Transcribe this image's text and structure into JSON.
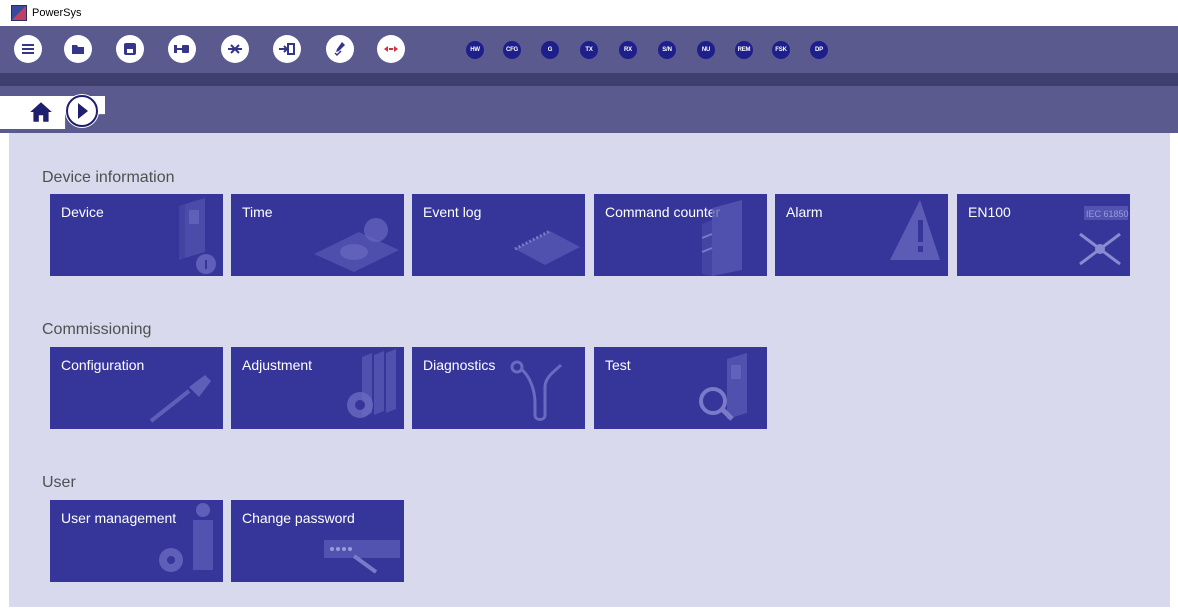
{
  "window": {
    "title": "PowerSys"
  },
  "toolbar": {
    "buttons": [
      {
        "name": "menu"
      },
      {
        "name": "open"
      },
      {
        "name": "save"
      },
      {
        "name": "connect"
      },
      {
        "name": "disconnect"
      },
      {
        "name": "login"
      },
      {
        "name": "edit"
      },
      {
        "name": "compare"
      }
    ],
    "status_labels": [
      "HW",
      "CFG",
      "G",
      "TX",
      "RX",
      "S/N",
      "NU",
      "REM",
      "FSK",
      "DP"
    ]
  },
  "colors": {
    "toolbar_bg": "#5a5a8e",
    "tile_bg": "#35359a",
    "content_bg": "#d9d9ee",
    "status_button_bg": "#1f1f8c"
  },
  "sections": [
    {
      "title": "Device information",
      "tiles": [
        {
          "label": "Device",
          "icon": "device-info-icon"
        },
        {
          "label": "Time",
          "icon": "clock-icon"
        },
        {
          "label": "Event log",
          "icon": "notebook-icon"
        },
        {
          "label": "Command counter",
          "icon": "cabinet-icon"
        },
        {
          "label": "Alarm",
          "icon": "warning-icon"
        },
        {
          "label": "EN100",
          "icon": "network-icon",
          "badge": "IEC 61850"
        }
      ]
    },
    {
      "title": "Commissioning",
      "tiles": [
        {
          "label": "Configuration",
          "icon": "screwdriver-icon"
        },
        {
          "label": "Adjustment",
          "icon": "gear-books-icon"
        },
        {
          "label": "Diagnostics",
          "icon": "stethoscope-icon"
        },
        {
          "label": "Test",
          "icon": "magnifier-icon"
        }
      ]
    },
    {
      "title": "User",
      "tiles": [
        {
          "label": "User management",
          "icon": "user-gear-icon"
        },
        {
          "label": "Change password",
          "icon": "password-icon"
        }
      ]
    }
  ]
}
